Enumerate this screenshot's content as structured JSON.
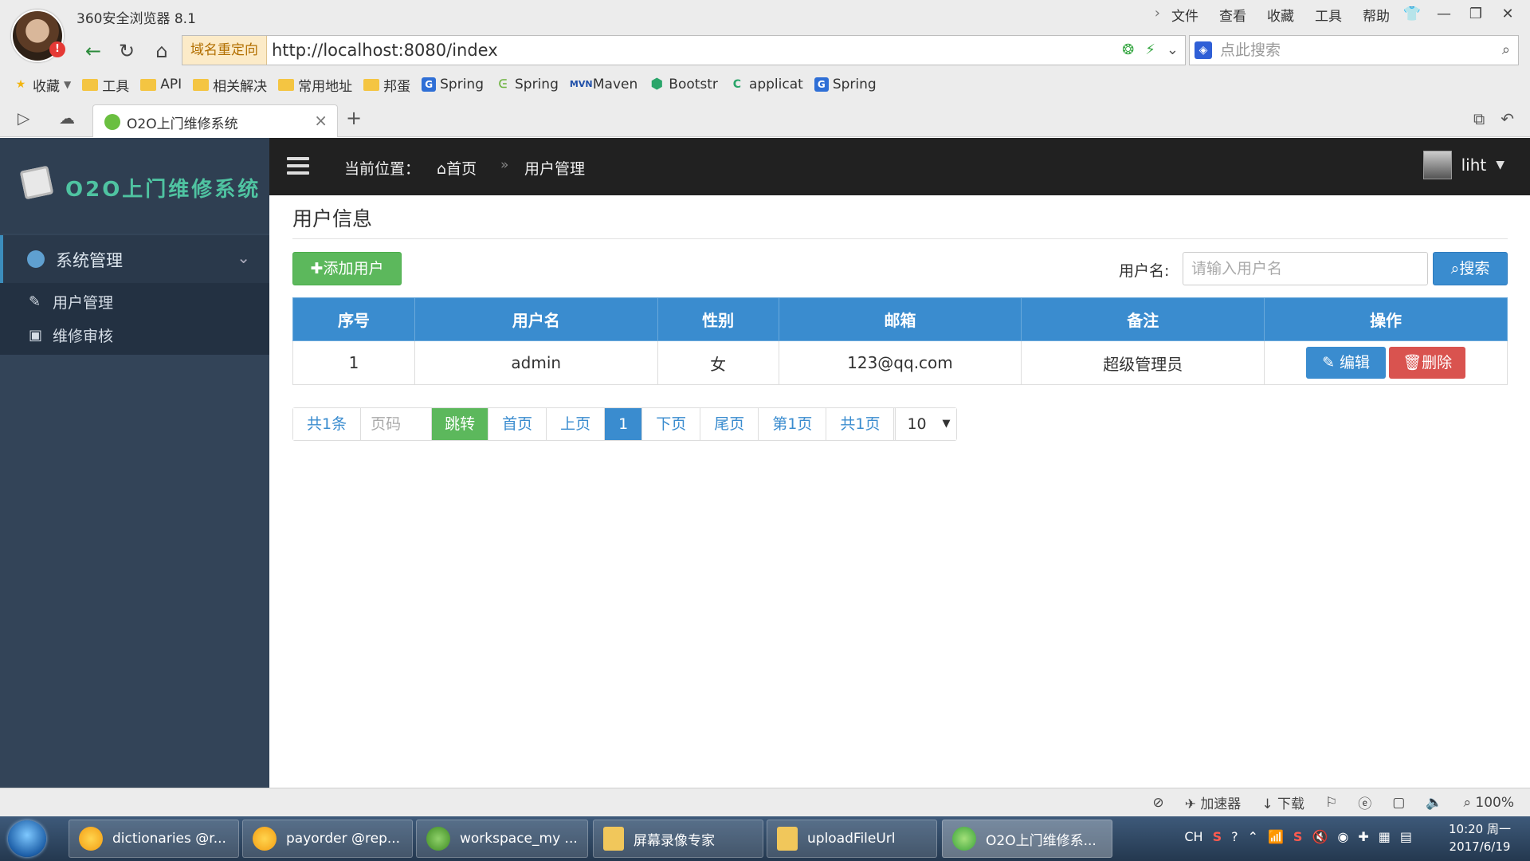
{
  "browser": {
    "name": "360安全浏览器 8.1",
    "menu": [
      "文件",
      "查看",
      "收藏",
      "工具",
      "帮助"
    ],
    "redirect_tag": "域名重定向",
    "url": "http://localhost:8080/index",
    "search_placeholder": "点此搜索",
    "bookmarks": [
      {
        "label": "收藏",
        "icon": "star-icon"
      },
      {
        "label": "工具",
        "icon": "folder-icon"
      },
      {
        "label": "API",
        "icon": "folder-icon"
      },
      {
        "label": "相关解决",
        "icon": "folder-icon"
      },
      {
        "label": "常用地址",
        "icon": "folder-icon"
      },
      {
        "label": "邦蛋",
        "icon": "folder-icon"
      },
      {
        "label": "Spring",
        "icon": "spring-icon"
      },
      {
        "label": "Spring",
        "icon": "spring-boot-icon"
      },
      {
        "label": "Maven",
        "icon": "maven-icon"
      },
      {
        "label": "Bootstr",
        "icon": "bootstrap-icon"
      },
      {
        "label": "applicat",
        "icon": "app-icon"
      },
      {
        "label": "Spring",
        "icon": "spring-icon"
      }
    ],
    "tab_title": "O2O上门维修系统",
    "status_items": [
      "加速器",
      "下载",
      "100%"
    ]
  },
  "app": {
    "brand": "O2O上门维修系统",
    "sidebar": {
      "group_label": "系统管理",
      "items": [
        {
          "label": "用户管理"
        },
        {
          "label": "维修审核"
        }
      ]
    },
    "header": {
      "crumb_prefix": "当前位置：",
      "crumb_home": "首页",
      "crumb_current": "用户管理",
      "username": "liht"
    },
    "main": {
      "title": "用户信息",
      "add_button": "添加用户",
      "search_label": "用户名:",
      "search_placeholder": "请输入用户名",
      "search_button": "搜索",
      "table": {
        "columns": [
          "序号",
          "用户名",
          "性别",
          "邮箱",
          "备注",
          "操作"
        ],
        "rows": [
          {
            "index": "1",
            "username": "admin",
            "gender": "女",
            "email": "123@qq.com",
            "note": "超级管理员",
            "edit": "编辑",
            "delete": "删除"
          }
        ]
      },
      "pager": {
        "total": "共1条",
        "page_placeholder": "页码",
        "jump": "跳转",
        "first": "首页",
        "prev": "上页",
        "current": "1",
        "next": "下页",
        "last": "尾页",
        "page_info": "第1页",
        "total_pages": "共1页",
        "page_size": "10"
      }
    }
  },
  "taskbar": {
    "items": [
      {
        "label": "dictionaries @r..."
      },
      {
        "label": "payorder @rep..."
      },
      {
        "label": "workspace_my ..."
      },
      {
        "label": "屏幕录像专家"
      },
      {
        "label": "uploadFileUrl"
      },
      {
        "label": "O2O上门维修系..."
      }
    ],
    "lang": "CH",
    "time": "10:20 周一",
    "date": "2017/6/19"
  },
  "colors": {
    "primary": "#3a8ccf",
    "success": "#5cb85c",
    "danger": "#d9534f",
    "sidebar": "#334458",
    "header": "#212121",
    "brand_text": "#4fc3a1"
  }
}
